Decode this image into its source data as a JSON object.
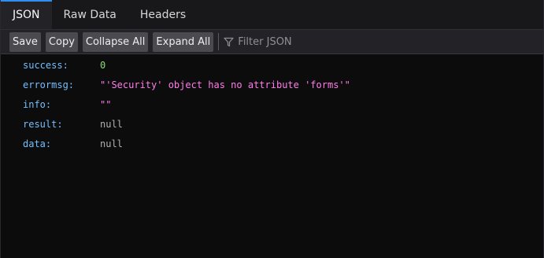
{
  "tabs": [
    {
      "label": "JSON",
      "active": true
    },
    {
      "label": "Raw Data",
      "active": false
    },
    {
      "label": "Headers",
      "active": false
    }
  ],
  "toolbar": {
    "save_label": "Save",
    "copy_label": "Copy",
    "collapse_label": "Collapse All",
    "expand_label": "Expand All",
    "filter_placeholder": "Filter JSON",
    "filter_icon": "filter-icon"
  },
  "json_rows": [
    {
      "key": "success:",
      "value": "0",
      "type": "number"
    },
    {
      "key": "errormsg:",
      "value": "\"'Security' object has no attribute 'forms'\"",
      "type": "string"
    },
    {
      "key": "info:",
      "value": "\"\"",
      "type": "string"
    },
    {
      "key": "result:",
      "value": "null",
      "type": "null"
    },
    {
      "key": "data:",
      "value": "null",
      "type": "null"
    }
  ],
  "colors": {
    "background": "#0c0c0d",
    "active_tab_accent": "#2f8ff0",
    "key": "#75bfff",
    "string": "#ff7de9",
    "number": "#86de74",
    "null": "#b1b1b3"
  }
}
